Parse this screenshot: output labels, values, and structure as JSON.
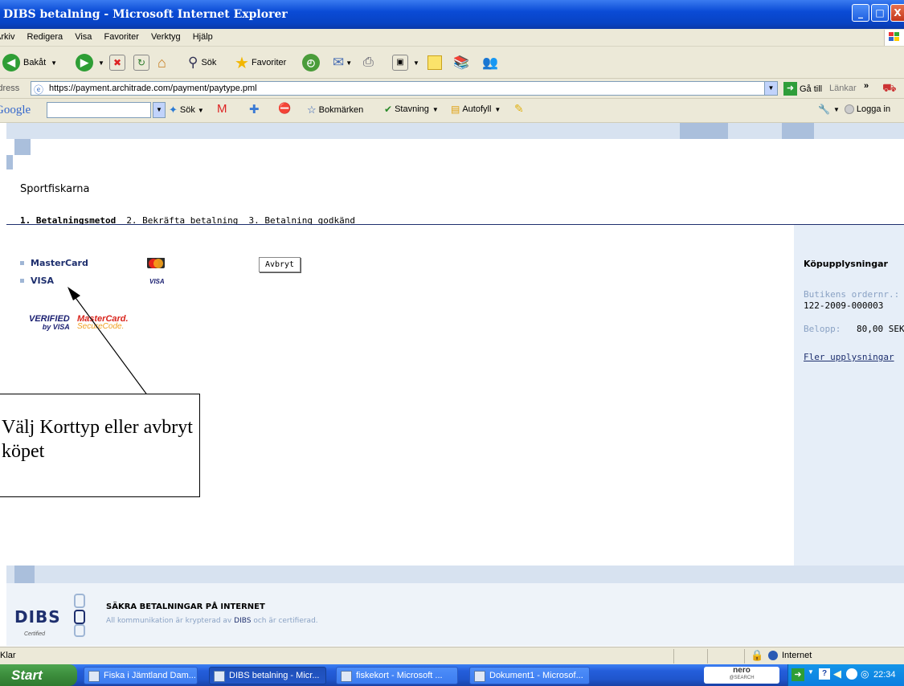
{
  "window": {
    "title": "DIBS betalning - Microsoft Internet Explorer"
  },
  "menu": [
    "Arkiv",
    "Redigera",
    "Visa",
    "Favoriter",
    "Verktyg",
    "Hjälp"
  ],
  "toolbar": {
    "back": "Bakåt",
    "search": "Sök",
    "favorites": "Favoriter"
  },
  "address": {
    "label": "Adress",
    "url": "https://payment.architrade.com/payment/paytype.pml",
    "go": "Gå till",
    "links": "Länkar"
  },
  "google": {
    "logo": "Google",
    "search": "Sök",
    "bookmarks": "Bokmärken",
    "spelling": "Stavning",
    "autofill": "Autofyll",
    "login": "Logga in"
  },
  "page": {
    "merchant": "Sportfiskarna",
    "steps": [
      "1. Betalningsmetod",
      "2. Bekräfta betalning",
      "3. Betalning godkänd"
    ],
    "cards": [
      "MasterCard",
      "VISA"
    ],
    "cancel": "Avbryt",
    "badges": {
      "verified": "VERIFIED",
      "by_visa": "by VISA",
      "mc": "MasterCard.",
      "securecode": "SecureCode."
    }
  },
  "sidebar": {
    "title": "Köpupplysningar",
    "order_label": "Butikens ordernr.:",
    "order_no": "122-2009-000003",
    "amount_label": "Belopp:",
    "amount": "80,00 SEK",
    "more": "Fler upplysningar"
  },
  "footer": {
    "logo": "DIBS",
    "certified": "Certified",
    "headline": "SÄKRA BETALNINGAR PÅ INTERNET",
    "text_before": "All kommunikation är krypterad av",
    "text_brand": "DIBS",
    "text_after": "och är certifierad."
  },
  "callout": {
    "text": "Välj Korttyp eller avbryt köpet"
  },
  "status": {
    "left": "Klar",
    "zone": "Internet"
  },
  "taskbar": {
    "start": "Start",
    "tasks": [
      "Fiska i Jämtland Dam...",
      "DIBS betalning - Micr...",
      "fiskekort - Microsoft ...",
      "Dokument1 - Microsof..."
    ],
    "nero": "nero",
    "nero_sub": "@SEARCH",
    "clock": "22:34"
  },
  "colors": {
    "xp_blue": "#0a4bd6",
    "page_navy": "#1e2f6e",
    "side_panel": "#e6eef8",
    "mc_red": "#d9251d",
    "visa_blue": "#1a1f71"
  }
}
